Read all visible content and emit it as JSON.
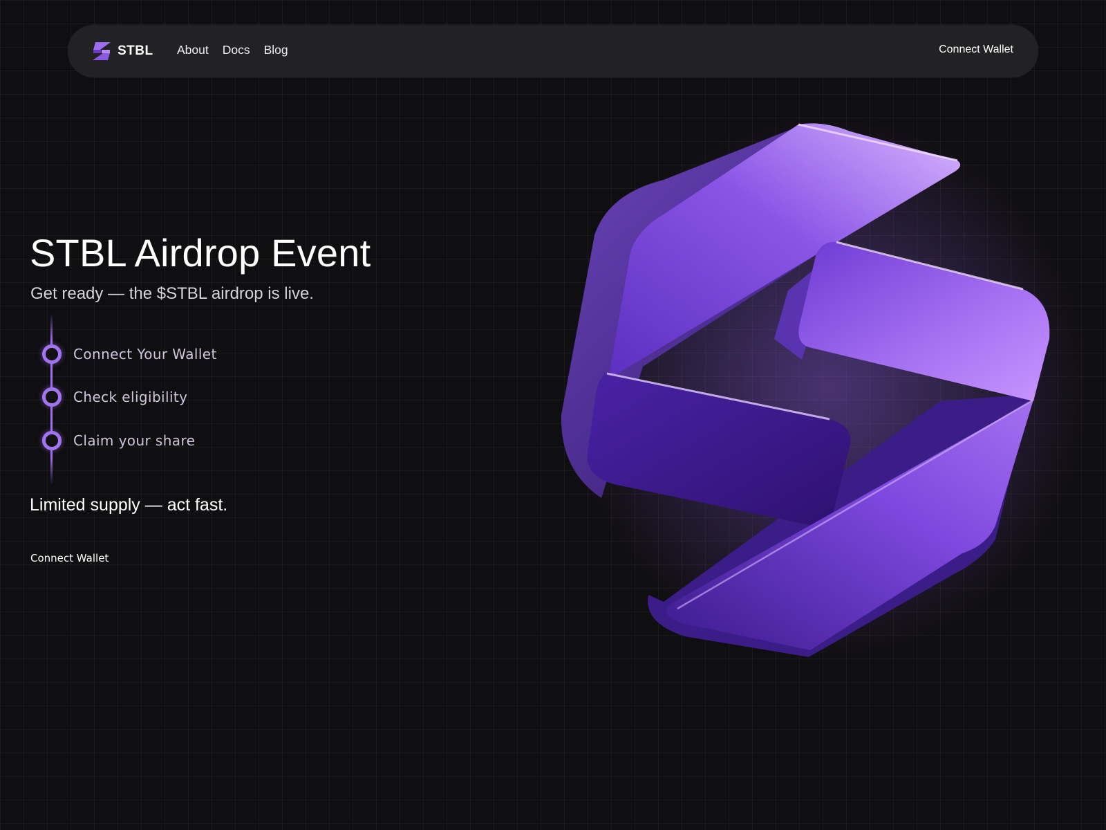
{
  "nav": {
    "brand": "STBL",
    "links": [
      "About",
      "Docs",
      "Blog"
    ],
    "connect_label": "Connect Wallet"
  },
  "hero": {
    "title": "STBL Airdrop Event",
    "subtitle": "Get ready — the $STBL airdrop is live.",
    "steps": [
      "Connect Your Wallet",
      "Check eligibility",
      "Claim your share"
    ],
    "note": "Limited supply — act fast.",
    "cta_label": "Connect Wallet"
  },
  "icons": {
    "brand_logo": "stbl-logo-icon",
    "step_marker": "timeline-dot-icon",
    "hero_art": "stbl-3d-logo-icon"
  },
  "colors": {
    "background": "#0f0e10",
    "nav_background": "#222123",
    "accent": "#a374f2",
    "logo_purple": "#7b4ad8",
    "text": "#ffffff",
    "muted_text": "#cfc6dc"
  }
}
